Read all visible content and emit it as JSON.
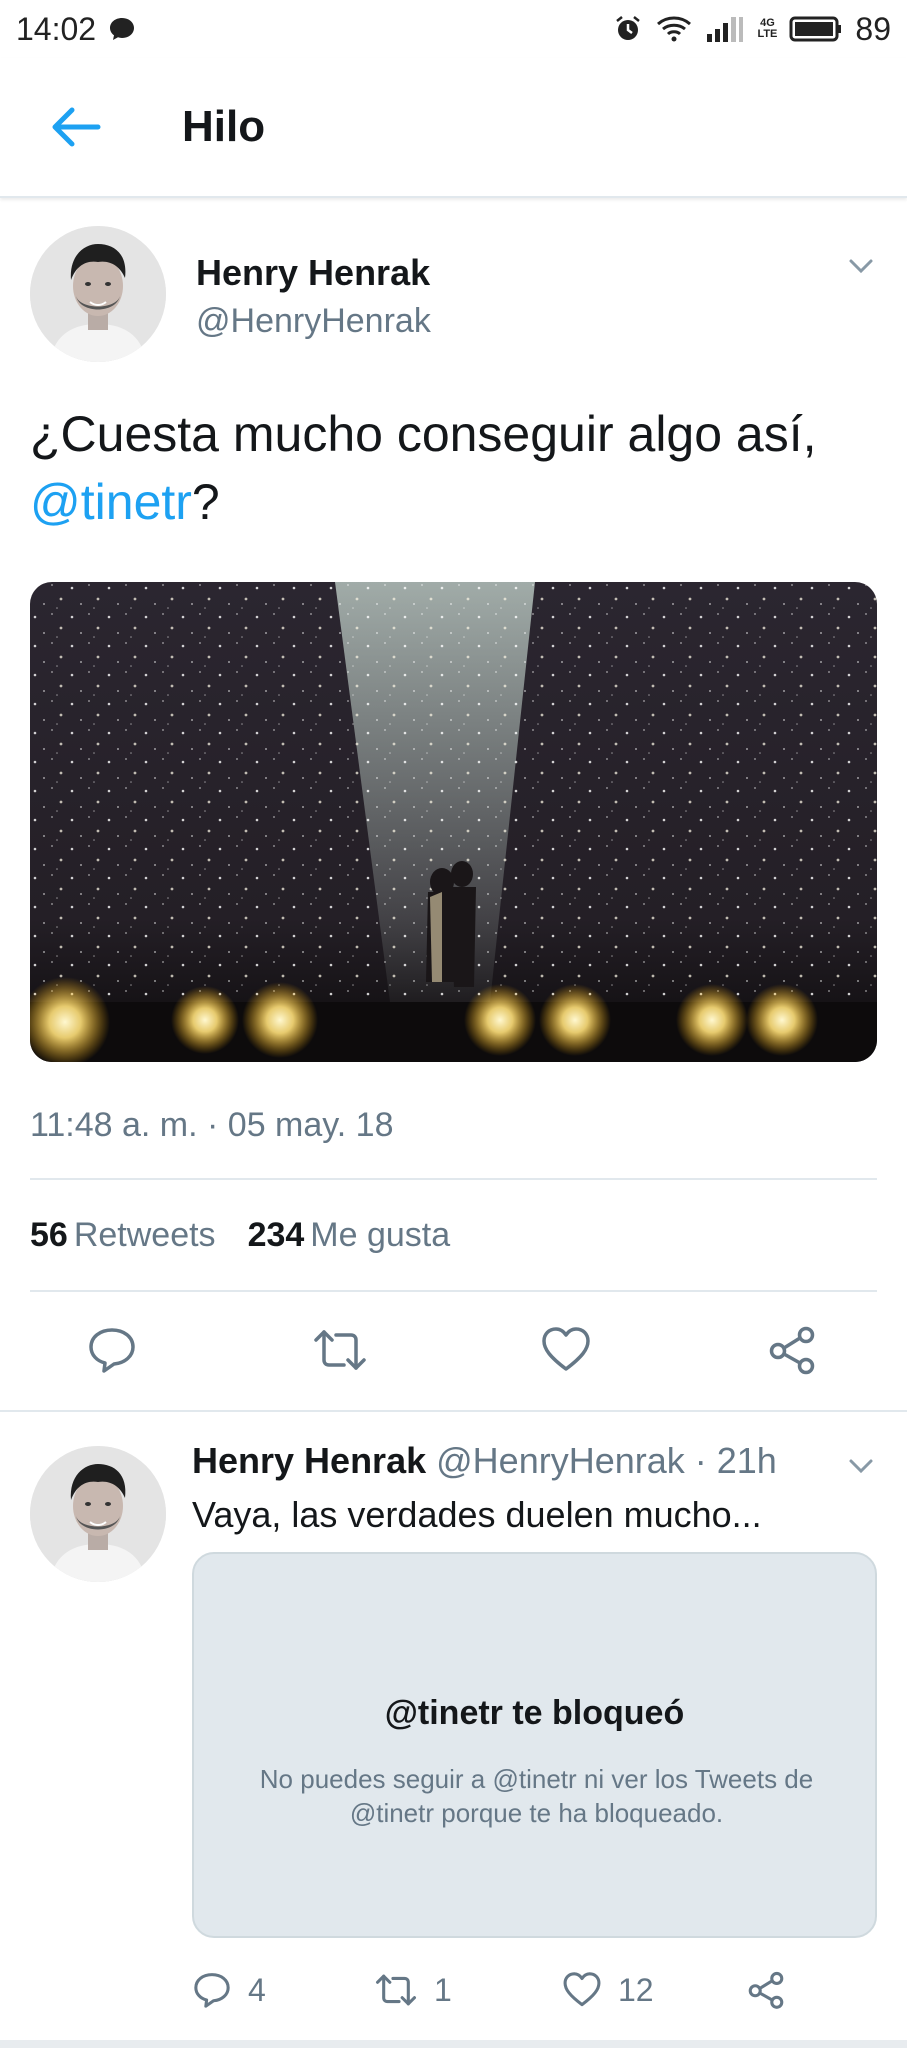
{
  "status_bar": {
    "time": "14:02",
    "network": "4G",
    "network_sub": "LTE",
    "battery": "89"
  },
  "header": {
    "title": "Hilo"
  },
  "main_tweet": {
    "author_name": "Henry Henrak",
    "author_handle": "@HenryHenrak",
    "text_before": "¿Cuesta mucho conseguir algo así, ",
    "mention": "@tinetr",
    "text_after": "?",
    "timestamp": "11:48 a. m. · 05 may. 18",
    "retweets_count": "56",
    "retweets_label": "Retweets",
    "likes_count": "234",
    "likes_label": "Me gusta"
  },
  "reply_tweet": {
    "author_name": "Henry Henrak",
    "author_meta": "@HenryHenrak · 21h",
    "text": "Vaya, las verdades duelen mucho...",
    "blocked_title": "@tinetr te bloqueó",
    "blocked_description": "No puedes seguir a @tinetr ni ver los Tweets de @tinetr porque te ha bloqueado.",
    "replies_count": "4",
    "retweets_count": "1",
    "likes_count": "12"
  },
  "colors": {
    "accent": "#1da1f2",
    "text_primary": "#14171a",
    "text_secondary": "#657786",
    "divider": "#e1e8ed"
  },
  "icons": {
    "back": "arrow-left-icon",
    "reply": "reply-icon",
    "retweet": "retweet-icon",
    "like": "heart-icon",
    "share": "share-icon",
    "caret": "chevron-down-icon"
  }
}
